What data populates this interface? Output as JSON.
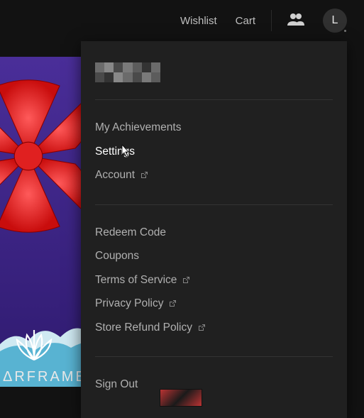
{
  "topbar": {
    "wishlist": "Wishlist",
    "cart": "Cart",
    "avatar_letter": "L"
  },
  "menu": {
    "group1": [
      {
        "label": "My Achievements",
        "external": false
      },
      {
        "label": "Settings",
        "external": false,
        "hover": true
      },
      {
        "label": "Account",
        "external": true
      }
    ],
    "group2": [
      {
        "label": "Redeem Code",
        "external": false
      },
      {
        "label": "Coupons",
        "external": false
      },
      {
        "label": "Terms of Service",
        "external": true
      },
      {
        "label": "Privacy Policy",
        "external": true
      },
      {
        "label": "Store Refund Policy",
        "external": true
      }
    ],
    "group3": [
      {
        "label": "Sign Out",
        "external": false
      }
    ]
  },
  "background": {
    "game_title": "ΔRFRAME"
  }
}
